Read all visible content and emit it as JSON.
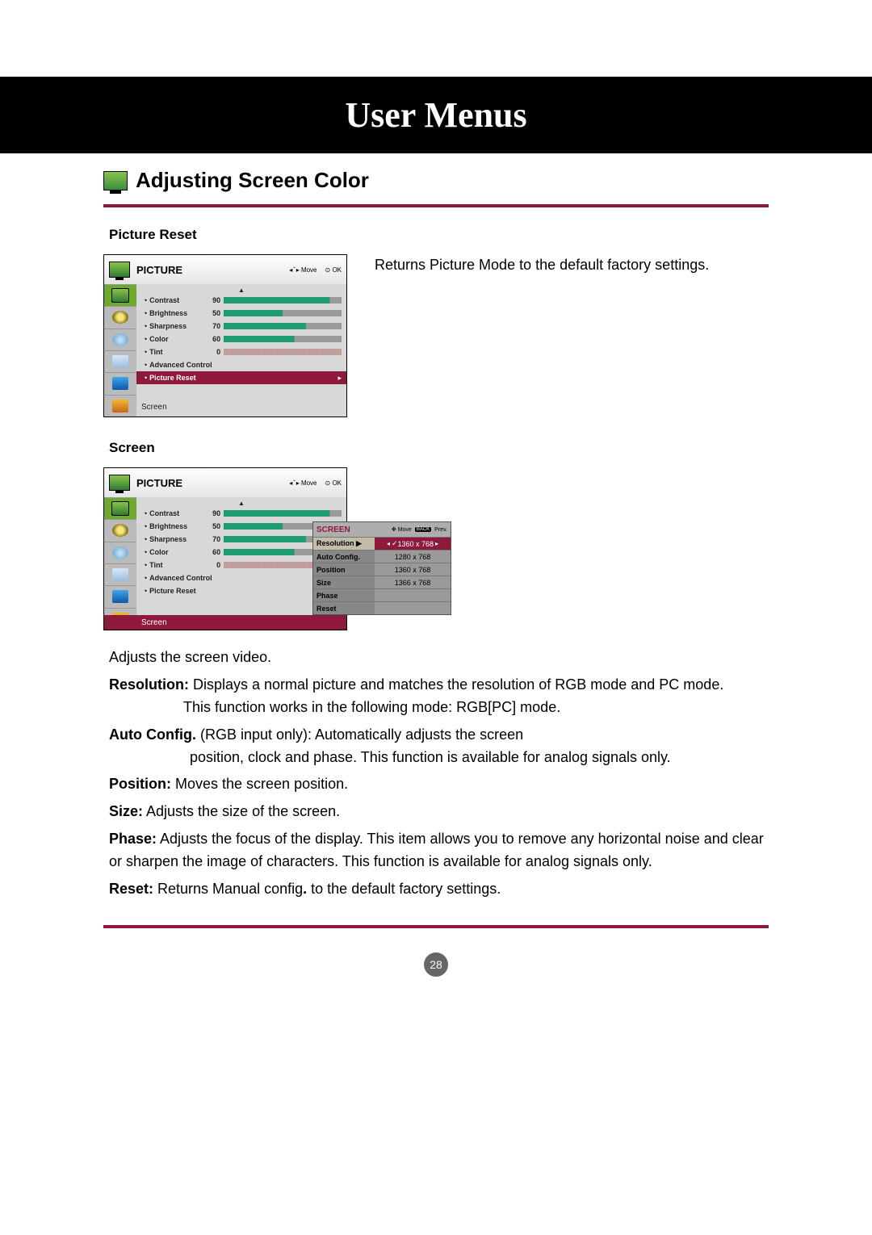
{
  "header": {
    "title": "User Menus"
  },
  "section": {
    "title": "Adjusting Screen Color"
  },
  "picture_reset": {
    "label": "Picture Reset",
    "desc": "Returns Picture Mode to  the default factory settings."
  },
  "screen": {
    "label": "Screen"
  },
  "osd1": {
    "title": "PICTURE",
    "hint_move": "Move",
    "hint_ok": "OK",
    "items": [
      {
        "name": "Contrast",
        "value": "90",
        "fill": 90
      },
      {
        "name": "Brightness",
        "value": "50",
        "fill": 50
      },
      {
        "name": "Sharpness",
        "value": "70",
        "fill": 70
      },
      {
        "name": "Color",
        "value": "60",
        "fill": 60
      },
      {
        "name": "Tint",
        "value": "0",
        "tint": true
      },
      {
        "name": "Advanced Control",
        "full": true
      },
      {
        "name": "Picture Reset",
        "full": true,
        "hl": true
      }
    ],
    "screen_label": "Screen"
  },
  "osd2": {
    "title": "PICTURE",
    "hint_move": "Move",
    "hint_ok": "OK",
    "items": [
      {
        "name": "Contrast",
        "value": "90",
        "fill": 90
      },
      {
        "name": "Brightness",
        "value": "50",
        "fill": 50
      },
      {
        "name": "Sharpness",
        "value": "70",
        "fill": 70
      },
      {
        "name": "Color",
        "value": "60",
        "fill": 60
      },
      {
        "name": "Tint",
        "value": "0",
        "tint": true
      },
      {
        "name": "Advanced Control",
        "full": true
      },
      {
        "name": "Picture Reset",
        "full": true
      }
    ],
    "screen_label": "Screen",
    "popup": {
      "title": "SCREEN",
      "hint_move": "Move",
      "hint_prev": "Prev.",
      "rows": [
        {
          "l": "Resolution ▶",
          "sel": true
        },
        {
          "l": "Auto Config."
        },
        {
          "l": "Position"
        },
        {
          "l": "Size"
        },
        {
          "l": "Phase"
        },
        {
          "l": "Reset"
        }
      ],
      "options": [
        {
          "label": "1360 x 768",
          "sel": true,
          "check": "✓"
        },
        {
          "label": "1280 x 768"
        },
        {
          "label": "1360 x 768"
        },
        {
          "label": "1366 x 768"
        }
      ]
    }
  },
  "body": {
    "l1": "Adjusts the screen video.",
    "res_b": "Resolution:",
    "res_t": " Displays a normal picture and matches the resolution of RGB mode and PC mode.",
    "res_t2": "This function works in the following mode: RGB[PC] mode.",
    "auto_b": "Auto Config.",
    "auto_t": " (RGB input only): Automatically adjusts the screen",
    "auto_t2": "position, clock and phase. This function is available for analog signals only.",
    "pos_b": "Position:",
    "pos_t": " Moves the screen position.",
    "size_b": "Size:",
    "size_t": " Adjusts the size of the screen.",
    "phase_b": "Phase:",
    "phase_t": " Adjusts the focus of the display. This item allows you to remove any horizontal noise and clear or sharpen the image of characters. This function is available for analog signals only.",
    "reset_b": "Reset:",
    "reset_t1": " Returns Manual config",
    "reset_dot": ".",
    "reset_t2": " to the default factory settings."
  },
  "page_number": "28"
}
